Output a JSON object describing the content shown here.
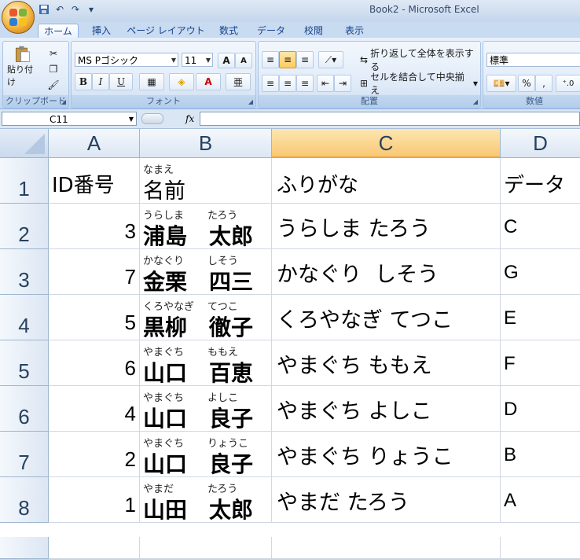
{
  "window": {
    "title": "Book2 - Microsoft Excel"
  },
  "tabs": [
    "ホーム",
    "挿入",
    "ページ レイアウト",
    "数式",
    "データ",
    "校閲",
    "表示"
  ],
  "ribbon": {
    "clipboard": {
      "paste_label": "貼り付け",
      "group_label": "クリップボード"
    },
    "font": {
      "name": "MS Pゴシック",
      "size": "11",
      "bold": "B",
      "italic": "I",
      "underline": "U",
      "grow": "A",
      "shrink": "A",
      "group_label": "フォント"
    },
    "alignment": {
      "wrap_label": "折り返して全体を表示する",
      "merge_label": "セルを結合して中央揃え",
      "group_label": "配置"
    },
    "number": {
      "format": "標準",
      "percent": "%",
      "comma": ",",
      "group_label": "数値"
    }
  },
  "formula_bar": {
    "name_box": "C11",
    "fx": "fx",
    "content": ""
  },
  "columns": [
    "A",
    "B",
    "C",
    "D"
  ],
  "selected_column": "C",
  "header_row": {
    "row": "1",
    "a": "ID番号",
    "b_furigana": "なまえ",
    "b": "名前",
    "c": "ふりがな",
    "d": "データ"
  },
  "rows": [
    {
      "row": "2",
      "id": "3",
      "family": "浦島",
      "given": "太郎",
      "family_furi": "うらしま",
      "given_furi": "たろう",
      "kana": "うらしま たろう",
      "data": "C"
    },
    {
      "row": "3",
      "id": "7",
      "family": "金栗",
      "given": "四三",
      "family_furi": "かなぐり",
      "given_furi": "しそう",
      "kana": "かなぐり  しそう",
      "data": "G"
    },
    {
      "row": "4",
      "id": "5",
      "family": "黒柳",
      "given": "徹子",
      "family_furi": "くろやなぎ",
      "given_furi": "てつこ",
      "kana": "くろやなぎ てつこ",
      "data": "E"
    },
    {
      "row": "5",
      "id": "6",
      "family": "山口",
      "given": "百恵",
      "family_furi": "やまぐち",
      "given_furi": "ももえ",
      "kana": "やまぐち ももえ",
      "data": "F"
    },
    {
      "row": "6",
      "id": "4",
      "family": "山口",
      "given": "良子",
      "family_furi": "やまぐち",
      "given_furi": "よしこ",
      "kana": "やまぐち よしこ",
      "data": "D"
    },
    {
      "row": "7",
      "id": "2",
      "family": "山口",
      "given": "良子",
      "family_furi": "やまぐち",
      "given_furi": "りょうこ",
      "kana": "やまぐち りょうこ",
      "data": "B"
    },
    {
      "row": "8",
      "id": "1",
      "family": "山田",
      "given": "太郎",
      "family_furi": "やまだ",
      "given_furi": "たろう",
      "kana": "やまだ たろう",
      "data": "A"
    }
  ]
}
